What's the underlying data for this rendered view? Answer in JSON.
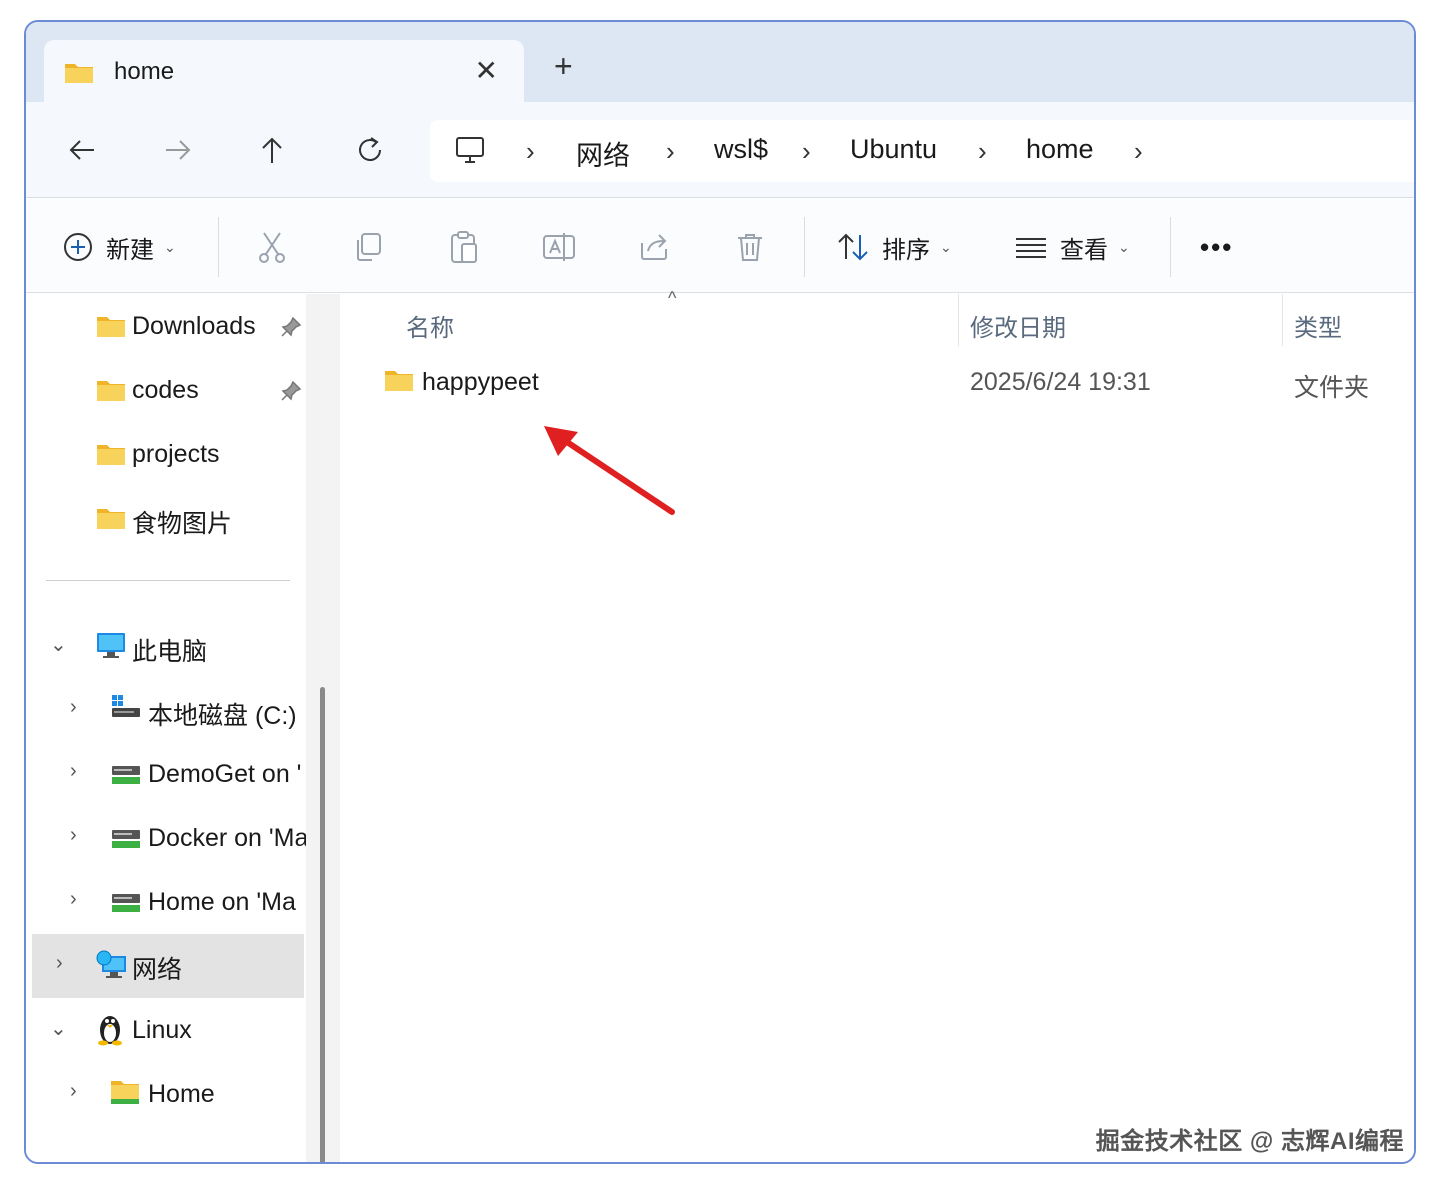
{
  "tab": {
    "title": "home",
    "close": "✕",
    "new_tab": "+"
  },
  "breadcrumb": [
    "网络",
    "wsl$",
    "Ubuntu",
    "home"
  ],
  "breadcrumb_sep": "›",
  "commands": {
    "new_label": "新建",
    "sort_label": "排序",
    "view_label": "查看",
    "more": "•••"
  },
  "sidebar": {
    "quick_access": [
      {
        "label": "Downloads",
        "pinned": true
      },
      {
        "label": "codes",
        "pinned": true
      },
      {
        "label": "projects",
        "pinned": false
      },
      {
        "label": "食物图片",
        "pinned": false
      }
    ],
    "this_pc": {
      "label": "此电脑",
      "expanded": true
    },
    "drives": [
      {
        "label": "本地磁盘 (C:)"
      },
      {
        "label": "DemoGet on '"
      },
      {
        "label": "Docker on 'Ma"
      },
      {
        "label": "Home on 'Ma"
      }
    ],
    "network": {
      "label": "网络",
      "selected": true
    },
    "linux": {
      "label": "Linux",
      "expanded": true
    },
    "linux_home": {
      "label": "Home"
    }
  },
  "columns": {
    "name": "名称",
    "modified": "修改日期",
    "type": "类型"
  },
  "files": [
    {
      "name": "happypeet",
      "modified": "2025/6/24 19:31",
      "type": "文件夹"
    }
  ],
  "watermark": "掘金技术社区 @ 志辉AI编程",
  "colors": {
    "accent_arrow": "#e02020",
    "folder": "#f6c744",
    "selected_bg": "#e3e3e3",
    "tab_strip": "#dde7f3"
  }
}
